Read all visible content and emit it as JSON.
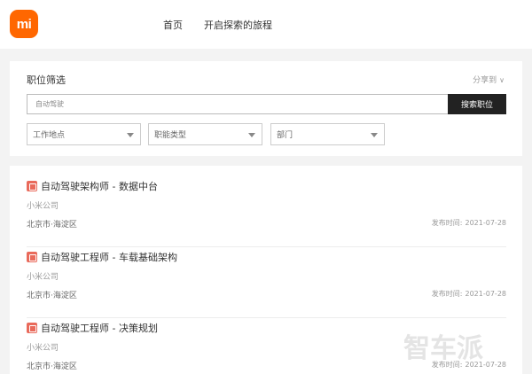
{
  "header": {
    "logo_text": "mi",
    "nav": [
      "首页",
      "开启探索的旅程"
    ]
  },
  "filter": {
    "title": "职位筛选",
    "share_label": "分享到",
    "search": {
      "value": "自动驾驶",
      "button": "搜索职位"
    },
    "selects": [
      {
        "value": "工作地点"
      },
      {
        "value": "职能类型"
      },
      {
        "value": "部门"
      }
    ]
  },
  "jobs": [
    {
      "title": "自动驾驶架构师 - 数据中台",
      "company": "小米公司",
      "location": "北京市·海淀区",
      "date_label": "发布时间:",
      "date": "2021-07-28"
    },
    {
      "title": "自动驾驶工程师 - 车载基础架构",
      "company": "小米公司",
      "location": "北京市·海淀区",
      "date_label": "发布时间:",
      "date": "2021-07-28"
    },
    {
      "title": "自动驾驶工程师 - 决策规划",
      "company": "小米公司",
      "location": "北京市·海淀区",
      "date_label": "发布时间:",
      "date": "2021-07-28"
    }
  ],
  "watermark": "智车派",
  "colors": {
    "brand": "#ff6700",
    "button": "#222222",
    "job_icon": "#e96a5b"
  }
}
